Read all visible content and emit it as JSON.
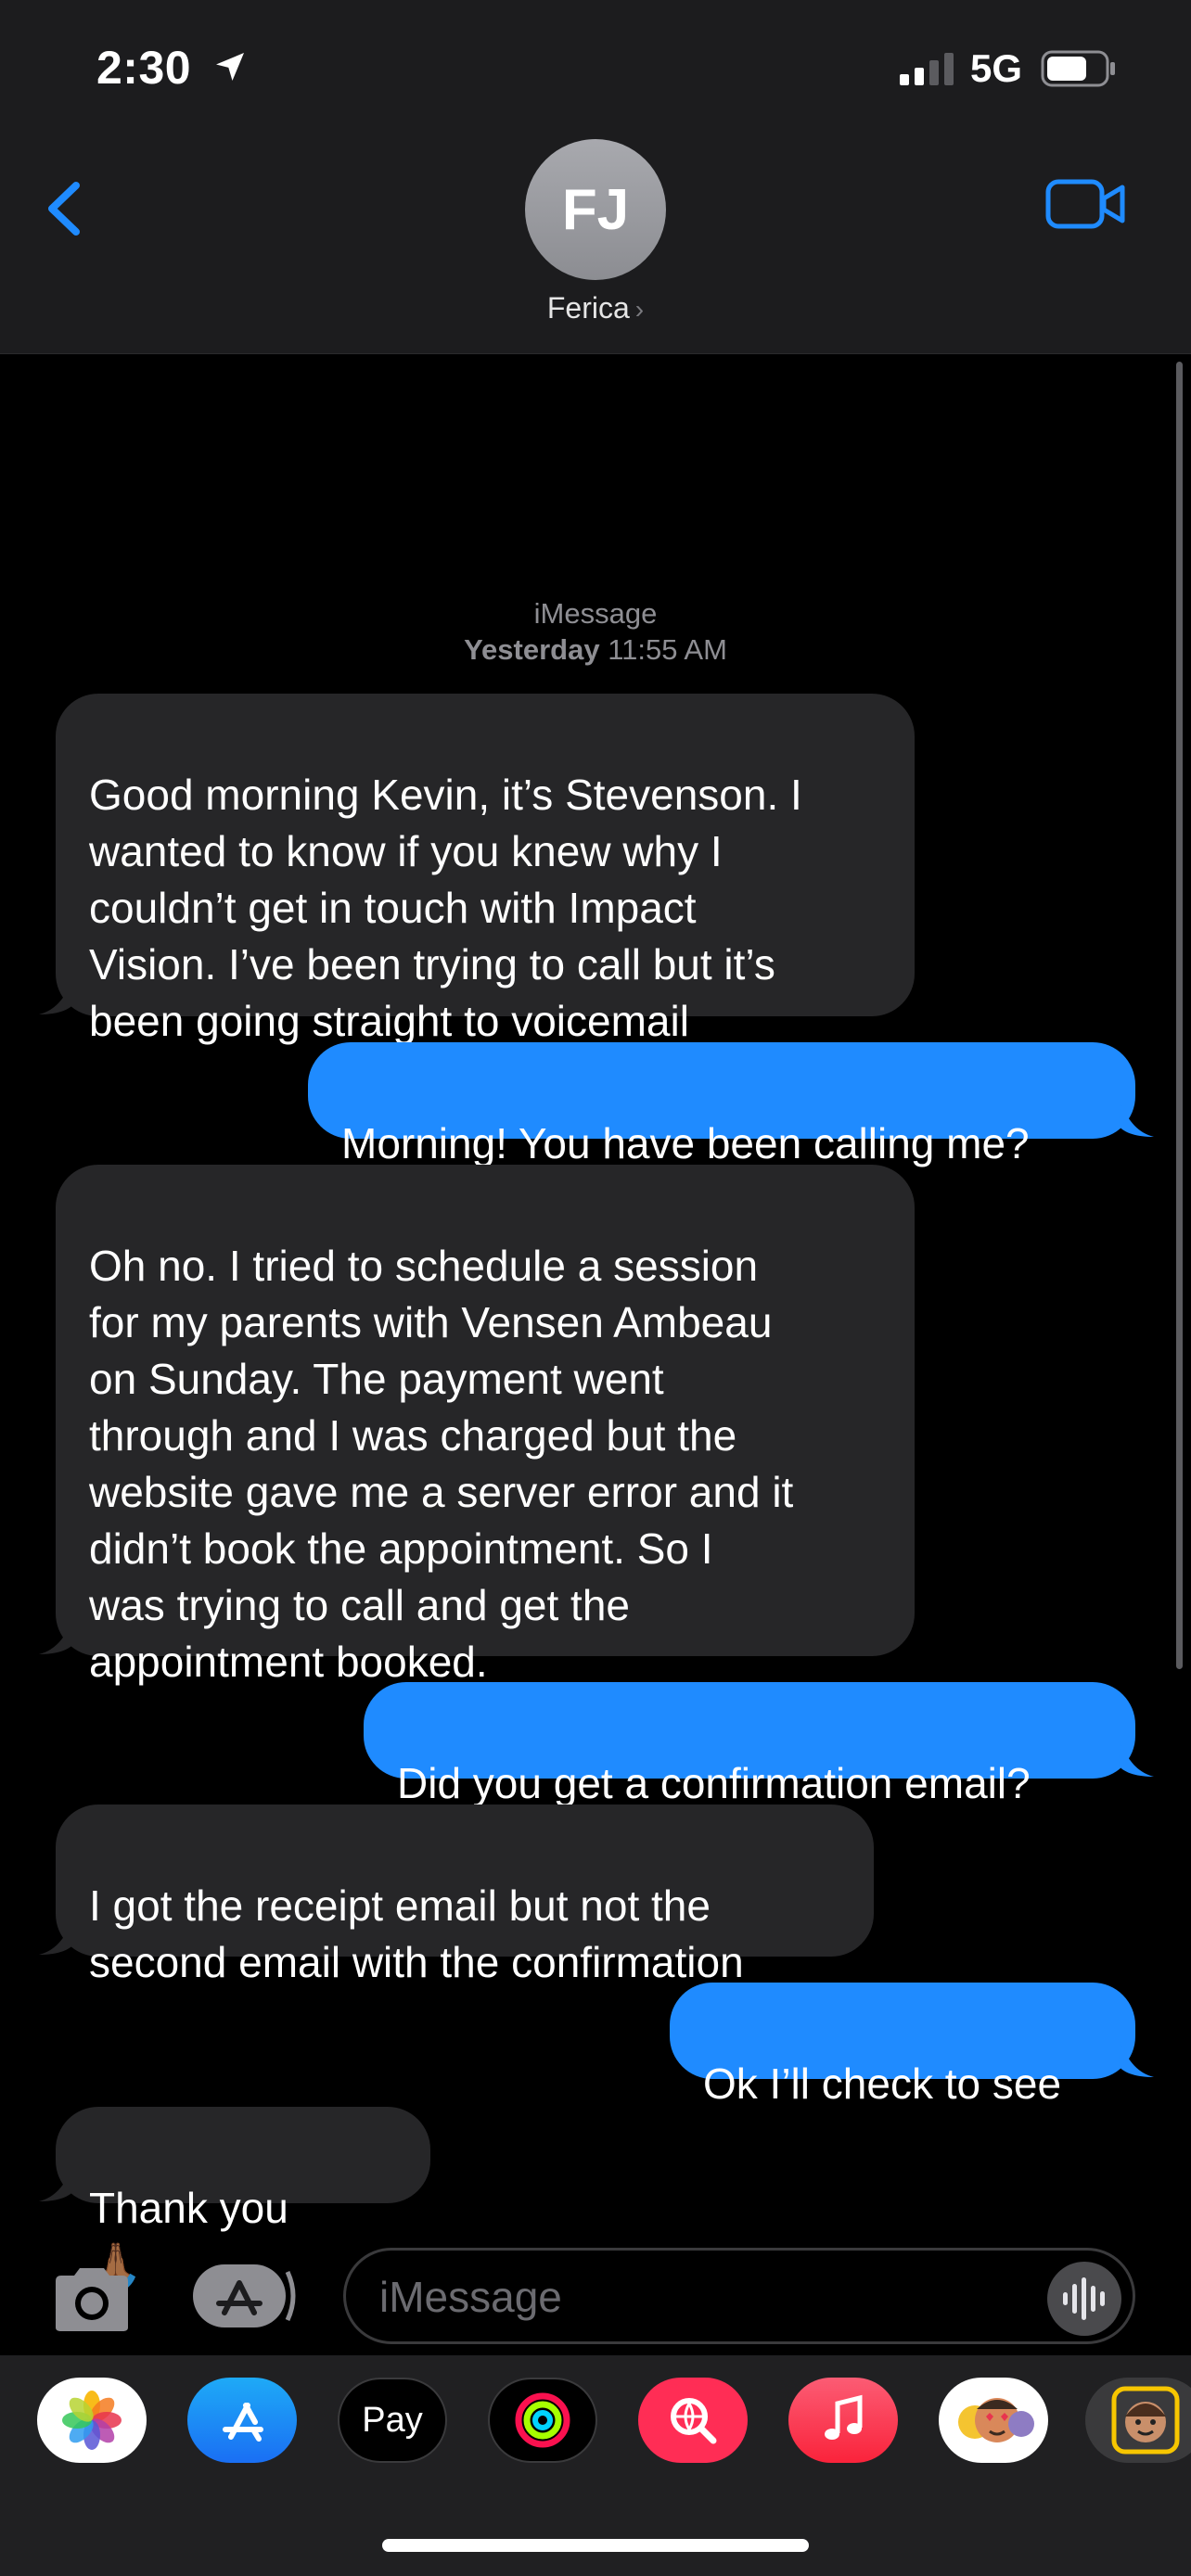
{
  "status_bar": {
    "time": "2:30",
    "network": "5G"
  },
  "header": {
    "avatar_initials": "FJ",
    "contact_name": "Ferica",
    "chevron": "›"
  },
  "thread": {
    "service": "iMessage",
    "timestamp_day": "Yesterday",
    "timestamp_time": "11:55 AM",
    "messages": [
      {
        "from": "them",
        "text": "Good morning Kevin, it’s Stevenson. I\nwanted to know if you knew why I\ncouldn’t get in touch with Impact\nVision. I’ve been trying to call but it’s\nbeen going straight to voicemail"
      },
      {
        "from": "me",
        "text": "Morning! You have been calling me?"
      },
      {
        "from": "them",
        "text": "Oh no. I tried to schedule a session\nfor my parents with Vensen Ambeau\non Sunday. The payment went\nthrough and I was charged but the\nwebsite gave me a server error and it\ndidn’t book the appointment. So I\nwas trying to call and get the\nappointment booked."
      },
      {
        "from": "me",
        "text": "Did you get a confirmation email?"
      },
      {
        "from": "them",
        "text": "I got the receipt email but not the\nsecond email with the confirmation"
      },
      {
        "from": "me",
        "text": "Ok I’ll check to see"
      },
      {
        "from": "them",
        "text": "Thank you",
        "emoji": "🙏🏾"
      }
    ]
  },
  "composer": {
    "placeholder": "iMessage"
  },
  "app_strip": {
    "apple_pay_label": "Pay",
    "apple_pay_logo": "",
    "icons": [
      "photos-icon",
      "app-store-icon",
      "apple-pay-icon",
      "activity-icon",
      "images-search-icon",
      "music-icon",
      "animoji-icon",
      "memoji-icon"
    ]
  },
  "colors": {
    "accent": "#1f8bff",
    "incoming_bubble": "#262628",
    "background": "#000000",
    "header": "#1c1c1e"
  }
}
